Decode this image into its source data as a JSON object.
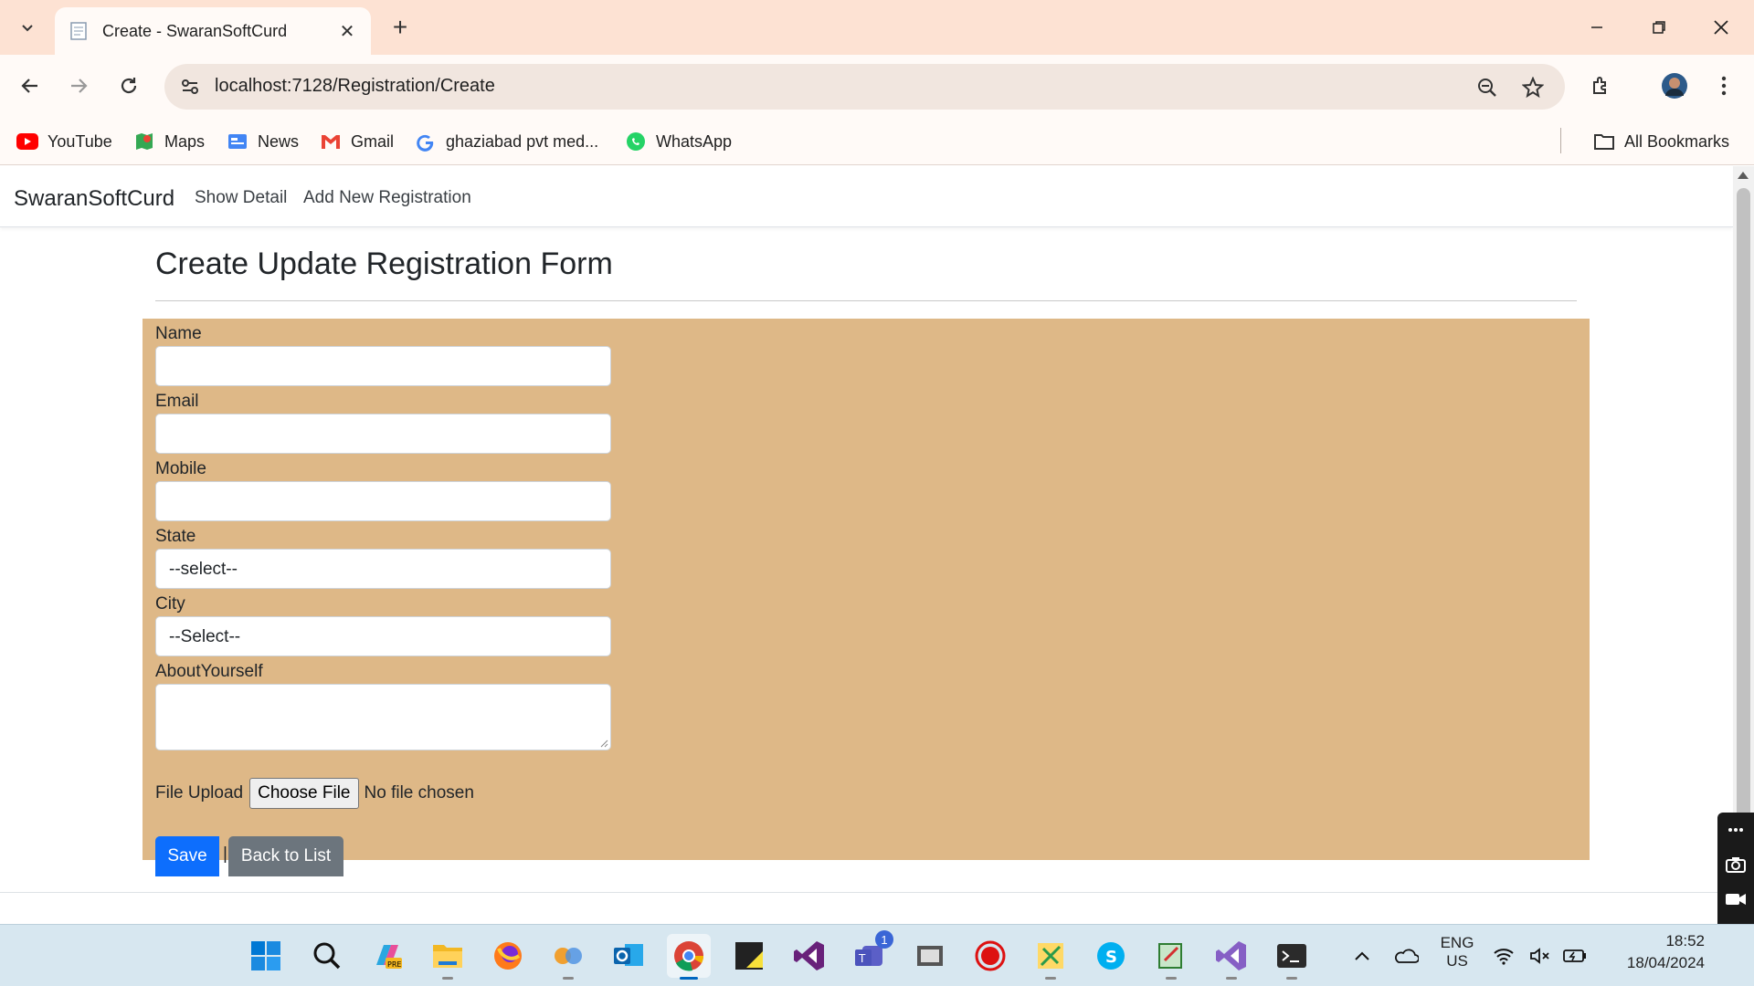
{
  "browser": {
    "tab_title": "Create - SwaranSoftCurd",
    "url": "localhost:7128/Registration/Create",
    "bookmarks": [
      {
        "label": "YouTube",
        "icon": "youtube-icon"
      },
      {
        "label": "Maps",
        "icon": "maps-icon"
      },
      {
        "label": "News",
        "icon": "news-icon"
      },
      {
        "label": "Gmail",
        "icon": "gmail-icon"
      },
      {
        "label": "ghaziabad pvt med...",
        "icon": "google-icon"
      },
      {
        "label": "WhatsApp",
        "icon": "whatsapp-icon"
      }
    ],
    "all_bookmarks": "All Bookmarks"
  },
  "navbar": {
    "brand": "SwaranSoftCurd",
    "links": [
      "Show Detail",
      "Add New Registration"
    ]
  },
  "form": {
    "heading": "Create Update Registration Form",
    "name_label": "Name",
    "email_label": "Email",
    "mobile_label": "Mobile",
    "state_label": "State",
    "state_value": "--select--",
    "city_label": "City",
    "city_value": "--Select--",
    "about_label": "AboutYourself",
    "file_label": "File Upload",
    "file_button": "Choose File",
    "file_status": "No file chosen",
    "save_label": "Save",
    "separator": "|",
    "back_label": "Back to List",
    "panel_color": "#deb887",
    "save_color": "#0d6efd",
    "back_color": "#6c757d"
  },
  "taskbar": {
    "apps": [
      "windows-start-icon",
      "search-icon",
      "copilot-icon",
      "file-explorer-icon",
      "firefox-icon",
      "app-icon",
      "outlook-icon",
      "chrome-icon",
      "sticky-notes-icon",
      "visual-studio-icon",
      "teams-icon",
      "media-icon",
      "record-icon",
      "paint-icon",
      "skype-icon",
      "notepad-icon",
      "visual-studio-2-icon",
      "terminal-icon"
    ],
    "teams_badge": "1",
    "lang_top": "ENG",
    "lang_bottom": "US",
    "time": "18:52",
    "date": "18/04/2024"
  }
}
